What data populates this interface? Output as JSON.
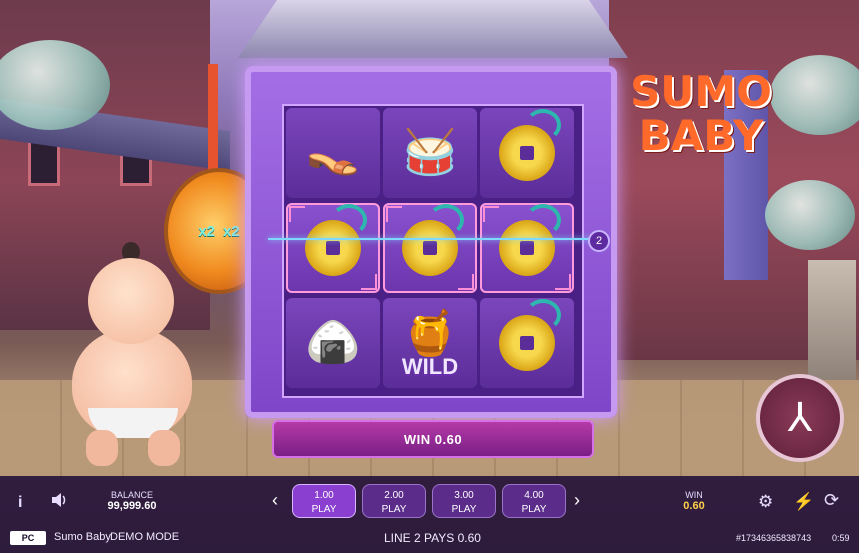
{
  "game": {
    "title_line1": "SUMO",
    "title_line2": "BABY",
    "medallion_left": "x2",
    "medallion_right": "x2",
    "win_banner": "WIN 0.60",
    "line_marker_right": "2"
  },
  "reels": [
    [
      "sandals",
      "drum",
      "coin"
    ],
    [
      "coin",
      "coin",
      "coin"
    ],
    [
      "onigiri",
      "wild",
      "coin"
    ]
  ],
  "symbols": {
    "sandals": "👡",
    "drum": "🥁",
    "onigiri": "🍙",
    "wild_icon": "🍯",
    "wild_label": "WILD"
  },
  "bottom_bar": {
    "info_icon": "i",
    "sound_icon": "speaker-icon",
    "balance_label": "BALANCE",
    "balance_value": "99,999.60",
    "bets": [
      {
        "amount": "1.00",
        "label": "PLAY"
      },
      {
        "amount": "2.00",
        "label": "PLAY"
      },
      {
        "amount": "3.00",
        "label": "PLAY"
      },
      {
        "amount": "4.00",
        "label": "PLAY"
      }
    ],
    "prev_arrow": "‹",
    "next_arrow": "›",
    "win_label": "WIN",
    "win_value": "0.60",
    "autoplay_icon": "⚙",
    "turbo_icon": "⚡",
    "refresh_icon": "⟳"
  },
  "footer": {
    "provider_logo": "PC",
    "game_name": "Sumo Baby",
    "mode": "DEMO MODE",
    "line_pays": "LINE 2 PAYS 0.60",
    "round_id": "#17346365838743",
    "time": "0:59"
  },
  "spin_button": {
    "glyph": "⅄"
  },
  "colors": {
    "accent": "#8a3fd0",
    "win": "#ffcf4a",
    "frame": "#a46fe6"
  }
}
